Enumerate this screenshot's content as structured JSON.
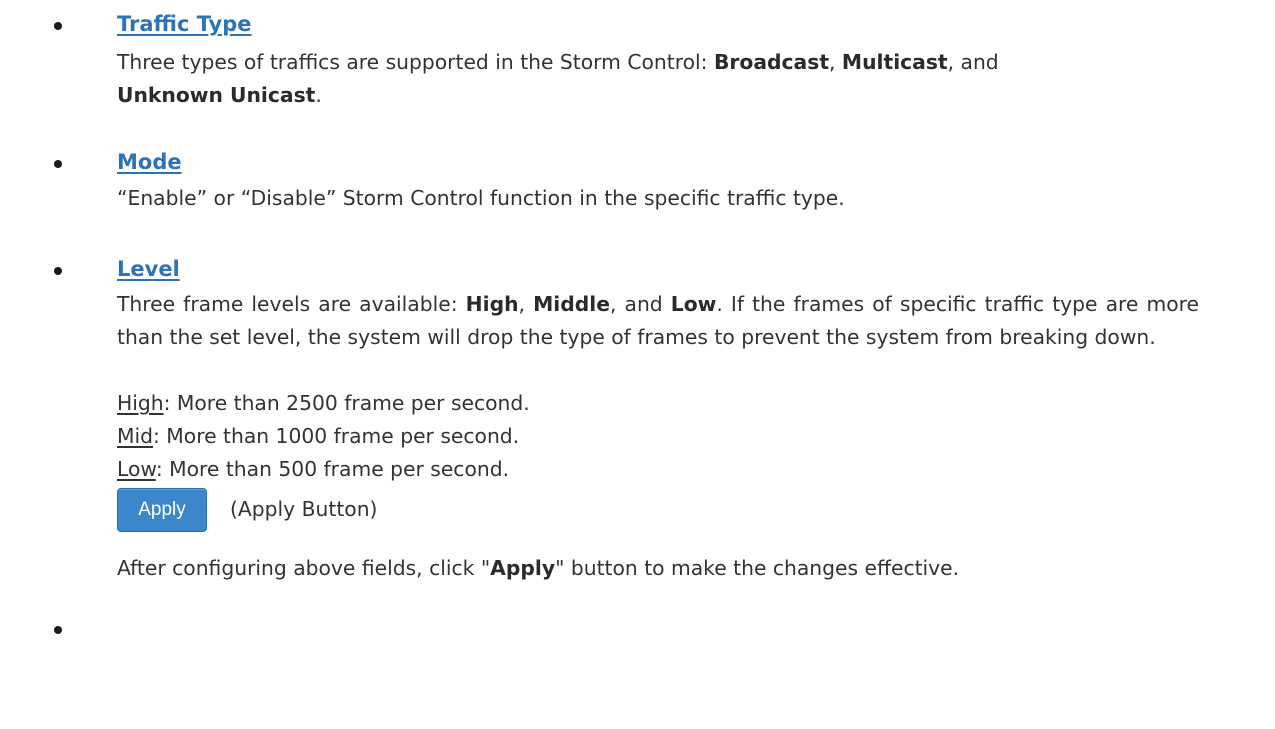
{
  "sections": {
    "traffic_type": {
      "heading": "Traffic Type",
      "text_1": "Three types of traffics are supported in the Storm Control: ",
      "bold_1": "Broadcast",
      "text_2": ", ",
      "bold_2": "Multicast",
      "text_3": ", and ",
      "bold_3": "Unknown Unicast",
      "text_4": "."
    },
    "mode": {
      "heading": "Mode",
      "text": "“Enable” or “Disable” Storm Control function in the specific traffic type."
    },
    "level": {
      "heading": "Level",
      "text_1": "Three frame levels are available: ",
      "bold_1": "High",
      "text_2": ", ",
      "bold_2": "Middle",
      "text_3": ", and ",
      "bold_3": "Low",
      "text_4": ". If the frames of specific traffic type are more than the set level, the system will drop the type of frames to prevent the system from breaking down.",
      "options": [
        {
          "name": "High",
          "desc": ": More than 2500 frame per second."
        },
        {
          "name": "Mid",
          "desc": ": More than 1000 frame per second."
        },
        {
          "name": "Low",
          "desc": ": More than 500 frame per second."
        }
      ]
    },
    "apply": {
      "button_label": "Apply",
      "caption": "(Apply Button)",
      "text_1": "After configuring above fields, click \"",
      "bold_1": "Apply",
      "text_2": "\" button to make the changes effective."
    }
  }
}
